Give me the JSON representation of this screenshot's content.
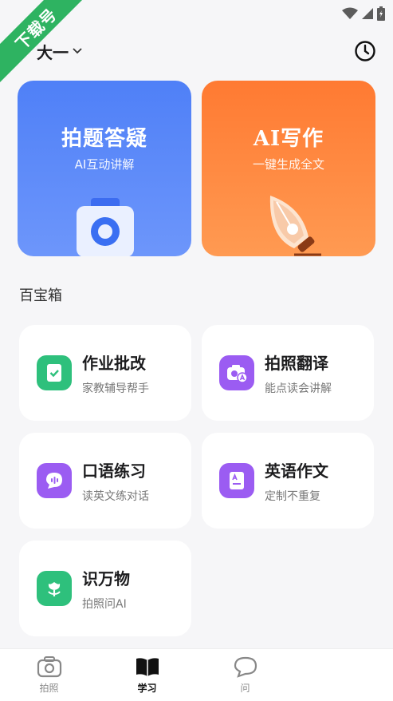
{
  "watermark": {
    "text": "下载号"
  },
  "header": {
    "grade_label": "大一",
    "icons": {
      "dropdown": "chevron-down-icon",
      "history": "clock-icon"
    }
  },
  "hero_cards": [
    {
      "title": "拍题答疑",
      "subtitle": "AI互动讲解",
      "icon": "camera-icon",
      "color": "#5a87f9"
    },
    {
      "title": "AI写作",
      "subtitle": "一键生成全文",
      "icon": "pen-nib-icon",
      "color": "#ff8440"
    }
  ],
  "toolbox": {
    "title": "百宝箱",
    "items": [
      {
        "name": "作业批改",
        "desc": "家教辅导帮手",
        "icon": "check-clipboard-icon",
        "color": "#2ec07c"
      },
      {
        "name": "拍照翻译",
        "desc": "能点读会讲解",
        "icon": "camera-translate-icon",
        "color": "#9b5cf2"
      },
      {
        "name": "口语练习",
        "desc": "读英文练对话",
        "icon": "chat-bubble-icon",
        "color": "#9b5cf2"
      },
      {
        "name": "英语作文",
        "desc": "定制不重复",
        "icon": "letter-document-icon",
        "color": "#9b5cf2"
      },
      {
        "name": "识万物",
        "desc": "拍照问AI",
        "icon": "flower-icon",
        "color": "#2ec07c"
      }
    ]
  },
  "tab_bar": {
    "tabs": [
      {
        "label": "拍照",
        "icon": "camera-icon",
        "active": false
      },
      {
        "label": "学习",
        "icon": "book-icon",
        "active": true
      },
      {
        "label": "问",
        "icon": "chat-icon",
        "active": false
      }
    ]
  }
}
